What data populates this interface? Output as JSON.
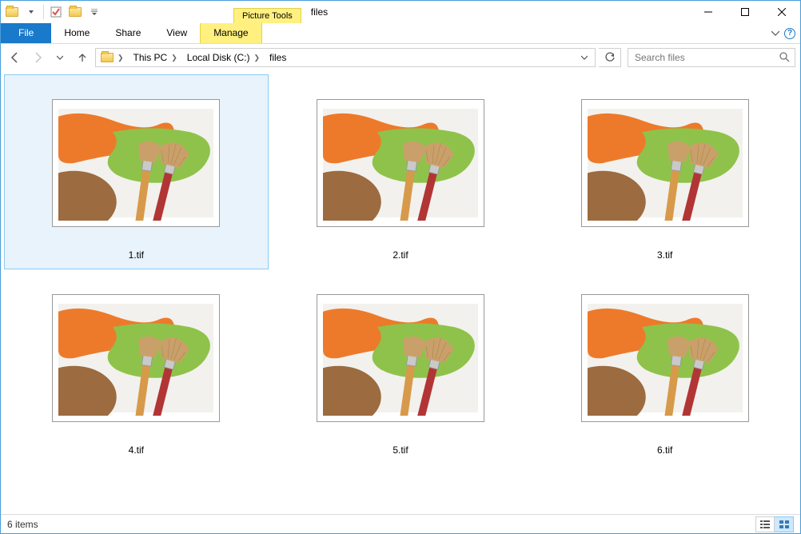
{
  "titlebar": {
    "context_tab_label": "Picture Tools",
    "window_title": "files"
  },
  "ribbon": {
    "file": "File",
    "tabs": [
      "Home",
      "Share",
      "View"
    ],
    "context_tab": "Manage"
  },
  "nav": {
    "breadcrumbs": [
      "This PC",
      "Local Disk (C:)",
      "files"
    ],
    "search_placeholder": "Search files"
  },
  "items": [
    {
      "name": "1.tif",
      "selected": true
    },
    {
      "name": "2.tif",
      "selected": false
    },
    {
      "name": "3.tif",
      "selected": false
    },
    {
      "name": "4.tif",
      "selected": false
    },
    {
      "name": "5.tif",
      "selected": false
    },
    {
      "name": "6.tif",
      "selected": false
    }
  ],
  "status": {
    "count_text": "6 items"
  }
}
